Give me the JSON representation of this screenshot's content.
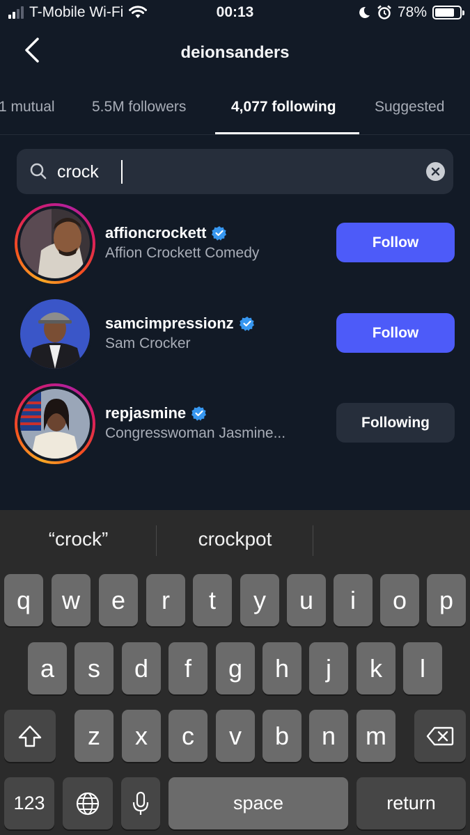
{
  "status_bar": {
    "carrier": "T-Mobile Wi-Fi",
    "time": "00:13",
    "battery": "78%",
    "battery_level": 0.78
  },
  "header": {
    "title": "deionsanders",
    "back_icon": "chevron-left-icon"
  },
  "tabs": [
    {
      "label": "1 mutual"
    },
    {
      "label": "5.5M followers"
    },
    {
      "label": "4,077 following",
      "active": true
    },
    {
      "label": "Suggested"
    }
  ],
  "search": {
    "value": "crock",
    "icon": "search-icon",
    "clear_icon": "clear-icon"
  },
  "results": [
    {
      "username": "affioncrockett",
      "full_name": "Affion Crockett Comedy",
      "verified": true,
      "story_ring": true,
      "button": "Follow"
    },
    {
      "username": "samcimpressionz",
      "full_name": "Sam Crocker",
      "verified": true,
      "story_ring": false,
      "button": "Follow"
    },
    {
      "username": "repjasmine",
      "full_name": "Congresswoman Jasmine...",
      "verified": true,
      "story_ring": true,
      "button": "Following"
    }
  ],
  "colors": {
    "background": "#121a26",
    "follow_button": "#4d5bf9",
    "following_button": "#262e3b",
    "verified_badge": "#3797f0"
  },
  "keyboard": {
    "suggestions": [
      "“crock”",
      "crockpot"
    ],
    "row1": [
      "q",
      "w",
      "e",
      "r",
      "t",
      "y",
      "u",
      "i",
      "o",
      "p"
    ],
    "row2": [
      "a",
      "s",
      "d",
      "f",
      "g",
      "h",
      "j",
      "k",
      "l"
    ],
    "row3": [
      "z",
      "x",
      "c",
      "v",
      "b",
      "n",
      "m"
    ],
    "shift_icon": "shift-icon",
    "delete_icon": "backspace-icon",
    "numbers_label": "123",
    "globe_icon": "globe-icon",
    "mic_icon": "microphone-icon",
    "space_label": "space",
    "return_label": "return"
  }
}
